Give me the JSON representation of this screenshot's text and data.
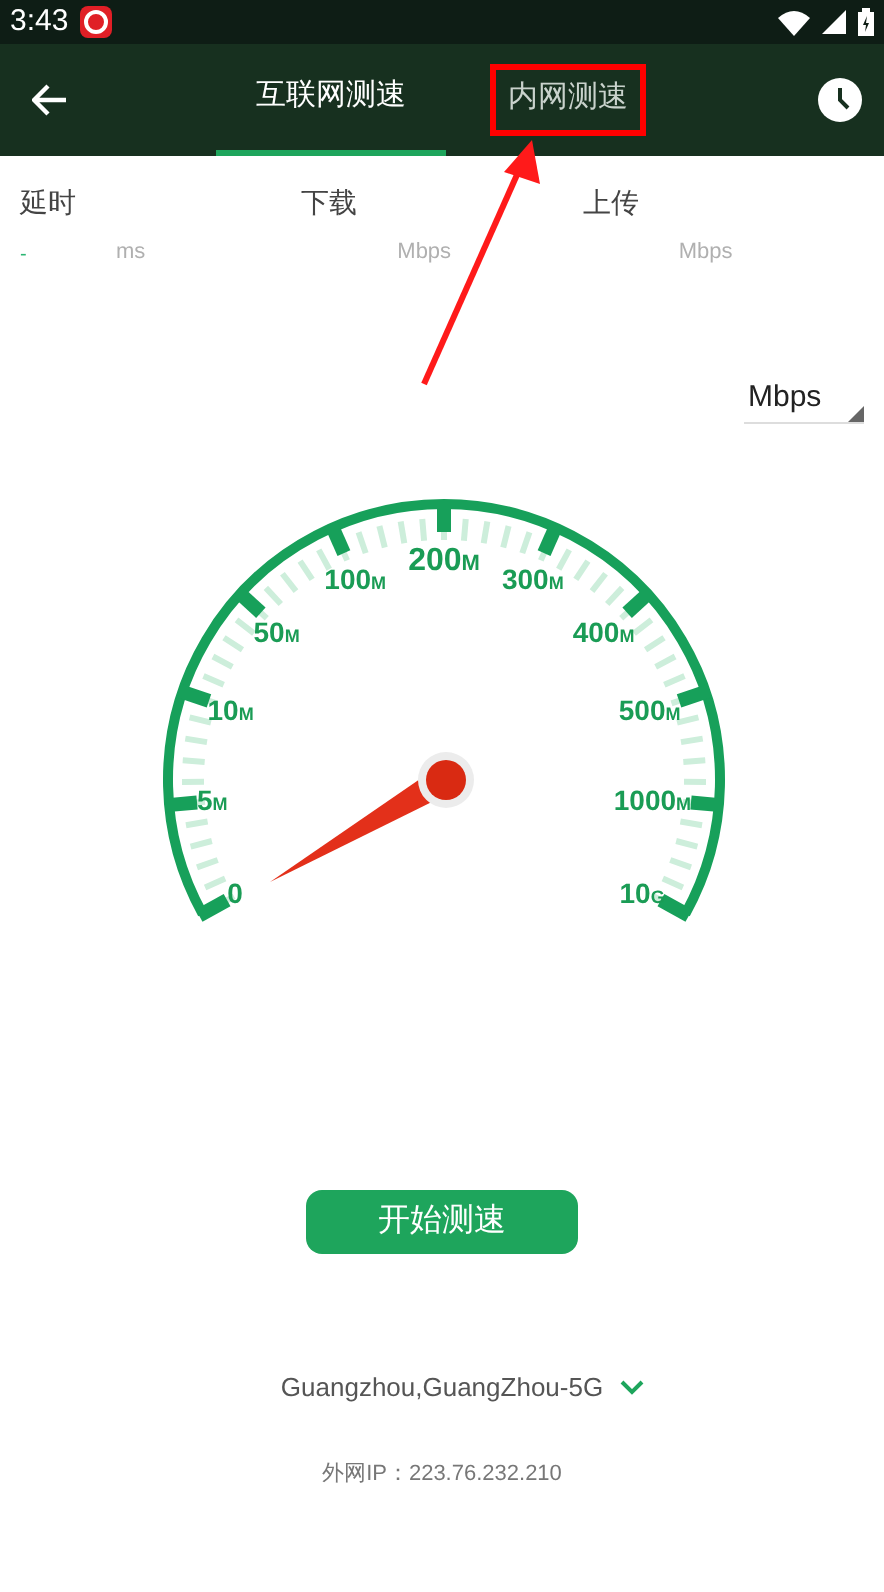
{
  "status_bar": {
    "time": "3:43"
  },
  "tabs": [
    {
      "label": "互联网测速",
      "selected": true
    },
    {
      "label": "内网测速",
      "selected": false
    }
  ],
  "annotation": {
    "kind": "highlight"
  },
  "metrics": [
    {
      "label": "延时",
      "value": "-",
      "unit": "ms"
    },
    {
      "label": "下载",
      "unit": "Mbps"
    },
    {
      "label": "上传",
      "unit": "Mbps"
    }
  ],
  "unit_dropdown": {
    "value": "Mbps"
  },
  "gauge": {
    "labels": [
      {
        "value": "0"
      },
      {
        "value": "5",
        "unit": "M"
      },
      {
        "value": "10",
        "unit": "M"
      },
      {
        "value": "50",
        "unit": "M"
      },
      {
        "value": "100",
        "unit": "M"
      },
      {
        "value": "200",
        "unit": "M"
      },
      {
        "value": "300",
        "unit": "M"
      },
      {
        "value": "400",
        "unit": "M"
      },
      {
        "value": "500",
        "unit": "M"
      },
      {
        "value": "1000",
        "unit": "M"
      },
      {
        "value": "10",
        "unit": "G"
      }
    ]
  },
  "start_button": "开始测速",
  "server": "Guangzhou,GuangZhou-5G",
  "external_ip": "外网IP：223.76.232.210"
}
